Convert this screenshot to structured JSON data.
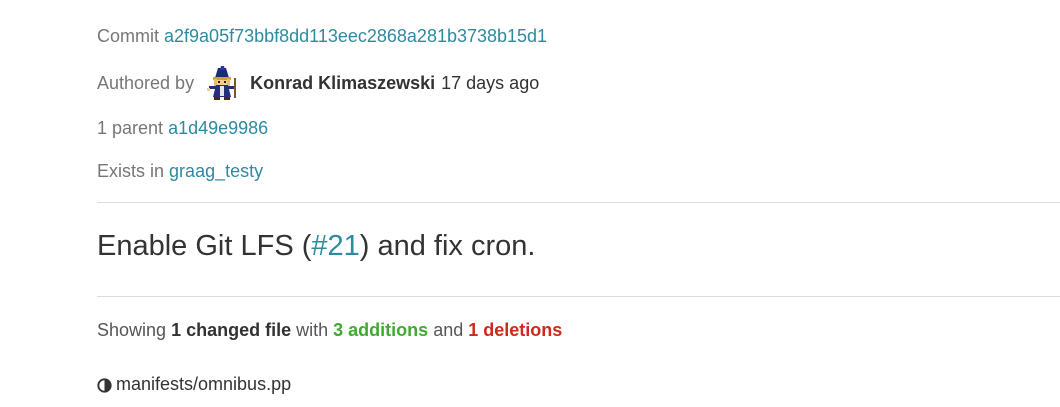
{
  "commit": {
    "label": "Commit",
    "hash": "a2f9a05f73bbf8dd113eec2868a281b3738b15d1"
  },
  "author": {
    "label": "Authored by",
    "name": "Konrad Klimaszewski",
    "time": "17 days ago",
    "avatar_icon": "pixel-wizard-avatar"
  },
  "parent": {
    "label": "1 parent",
    "hash": "a1d49e9986"
  },
  "exists": {
    "label": "Exists in",
    "branch": "graag_testy"
  },
  "message": {
    "before": "Enable Git LFS (",
    "ref": "#21",
    "after": ") and fix cron."
  },
  "summary": {
    "showing": "Showing",
    "changed": "1 changed file",
    "with": "with",
    "additions": "3 additions",
    "and": "and",
    "deletions": "1 deletions"
  },
  "files": [
    {
      "icon": "half-circle-icon",
      "path": "manifests/omnibus.pp"
    }
  ],
  "colors": {
    "link": "#2e8aa0",
    "additions": "#3faa2e",
    "deletions": "#cc2a1a",
    "divider": "#dddddd"
  }
}
